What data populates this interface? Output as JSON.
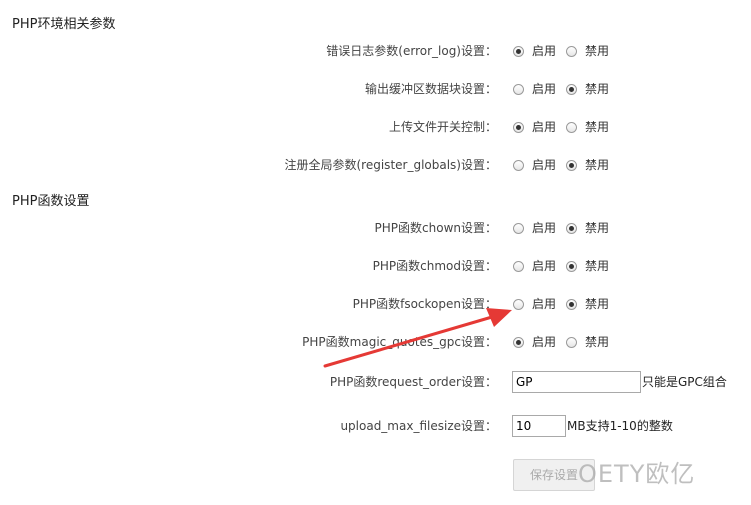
{
  "sections": {
    "env_title": "PHP环境相关参数",
    "func_title": "PHP函数设置"
  },
  "option_labels": {
    "enable": "启用",
    "disable": "禁用"
  },
  "env_settings": [
    {
      "label": "错误日志参数(error_log)设置：",
      "selected": "enable"
    },
    {
      "label": "输出缓冲区数据块设置：",
      "selected": "disable"
    },
    {
      "label": "上传文件开关控制：",
      "selected": "enable"
    },
    {
      "label": "注册全局参数(register_globals)设置：",
      "selected": "disable"
    }
  ],
  "func_settings": [
    {
      "label": "PHP函数chown设置：",
      "selected": "disable"
    },
    {
      "label": "PHP函数chmod设置：",
      "selected": "disable"
    },
    {
      "label": "PHP函数fsockopen设置：",
      "selected": "disable"
    },
    {
      "label": "PHP函数magic_quotes_gpc设置：",
      "selected": "enable"
    }
  ],
  "request_order": {
    "label": "PHP函数request_order设置：",
    "value": "GP",
    "hint": "只能是GPC组合"
  },
  "upload_max": {
    "label": "upload_max_filesize设置：",
    "value": "10",
    "hint": "MB支持1-10的整数"
  },
  "save_button": "保存设置",
  "watermark": "OETY欧亿",
  "colors": {
    "arrow": "#e53935",
    "text": "#333333",
    "disabled_button_text": "#aaaaaa"
  }
}
